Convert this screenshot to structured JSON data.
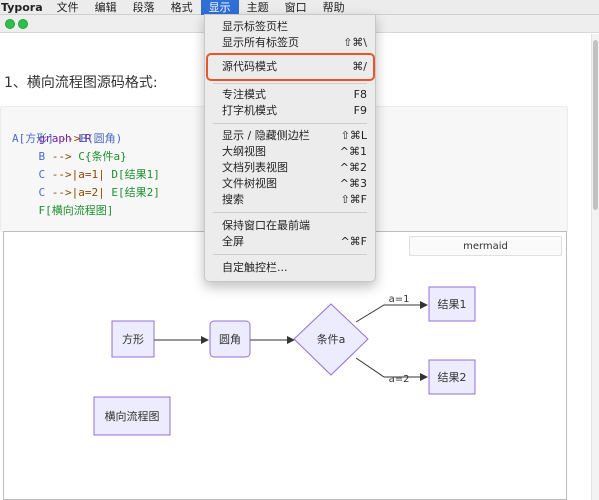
{
  "menubar": {
    "app": "Typora",
    "items": [
      "文件",
      "编辑",
      "段落",
      "格式",
      "显示",
      "主题",
      "窗口",
      "帮助"
    ],
    "active_index": 4
  },
  "document": {
    "heading": "1、横向流程图源码格式:",
    "code": {
      "line1": "graph LR",
      "line2": {
        "a": "A[方形]",
        "arrow": " -->",
        "b": "B(圆角)"
      },
      "line3": {
        "indent": "    ",
        "b": "B",
        "arrow": " --> ",
        "c": "C{条件a}"
      },
      "line4": {
        "indent": "    ",
        "c": "C",
        "arrow": " -->|a=1| ",
        "d": "D[结果1]"
      },
      "line5": {
        "indent": "    ",
        "c": "C",
        "arrow": " -->|a=2| ",
        "e": "E[结果2]"
      },
      "line6": {
        "indent": "    ",
        "f": "F[横向流程图]"
      }
    },
    "diagram": {
      "language_tag": "mermaid",
      "nodes": {
        "a": "方形",
        "b": "圆角",
        "c": "条件a",
        "d": "结果1",
        "e": "结果2",
        "f": "横向流程图"
      },
      "edge_labels": {
        "cd": "a=1",
        "ce": "a=2"
      },
      "colors": {
        "node_fill": "#ececfe",
        "node_stroke": "#9370db",
        "edge": "#333333"
      }
    }
  },
  "view_menu": {
    "group1": [
      {
        "label": "显示标签页栏",
        "shortcut": ""
      },
      {
        "label": "显示所有标签页",
        "shortcut": "⇧⌘\\"
      }
    ],
    "group2": [
      {
        "label": "源代码模式",
        "shortcut": "⌘/"
      }
    ],
    "group3": [
      {
        "label": "专注模式",
        "shortcut": "F8"
      },
      {
        "label": "打字机模式",
        "shortcut": "F9"
      }
    ],
    "group4": [
      {
        "label": "显示 / 隐藏侧边栏",
        "shortcut": "⇧⌘L"
      },
      {
        "label": "大纲视图",
        "shortcut": "^⌘1"
      },
      {
        "label": "文档列表视图",
        "shortcut": "^⌘2"
      },
      {
        "label": "文件树视图",
        "shortcut": "^⌘3"
      },
      {
        "label": "搜索",
        "shortcut": "⇧⌘F"
      }
    ],
    "group5": [
      {
        "label": "保持窗口在最前端",
        "shortcut": ""
      },
      {
        "label": "全屏",
        "shortcut": "^⌘F"
      }
    ],
    "group6": [
      {
        "label": "自定触控栏...",
        "shortcut": ""
      }
    ],
    "highlight_color": "#e8552a",
    "highlighted_item": "源代码模式"
  }
}
